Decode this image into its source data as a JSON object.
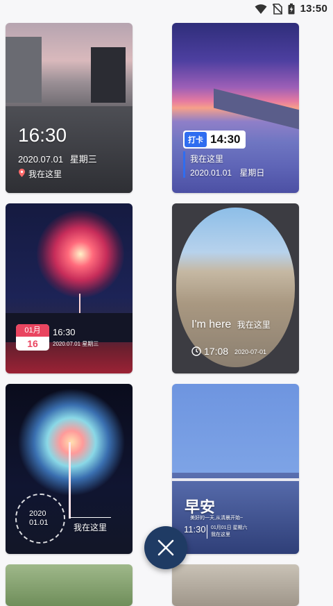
{
  "status_bar": {
    "time": "13:50",
    "icons": [
      "wifi-icon",
      "no-sim-icon",
      "battery-icon"
    ]
  },
  "templates": [
    {
      "time": "16:30",
      "date": "2020.07.01",
      "weekday": "星期三",
      "location": "我在这里"
    },
    {
      "tag": "打卡",
      "time": "14:30",
      "location": "我在这里",
      "date": "2020.01.01",
      "weekday": "星期日"
    },
    {
      "month": "01月",
      "day": "16",
      "time": "16:30",
      "date_line": "2020.07.01 星期三"
    },
    {
      "here_en": "I'm here",
      "location": "我在这里",
      "time": "17:08",
      "date": "2020-07-01"
    },
    {
      "year": "2020",
      "month_day": "01.01",
      "location": "我在这里"
    },
    {
      "greeting": "早安",
      "subtitle": "美好的一天,从清晨开始~",
      "time": "11:30",
      "date_line": "01月01日 星期六",
      "location": "我在这里"
    }
  ],
  "fab": {
    "icon": "close-icon"
  },
  "colors": {
    "accent": "#2f6df0",
    "fab": "#1f3b64",
    "calendar_red": "#e94560"
  }
}
